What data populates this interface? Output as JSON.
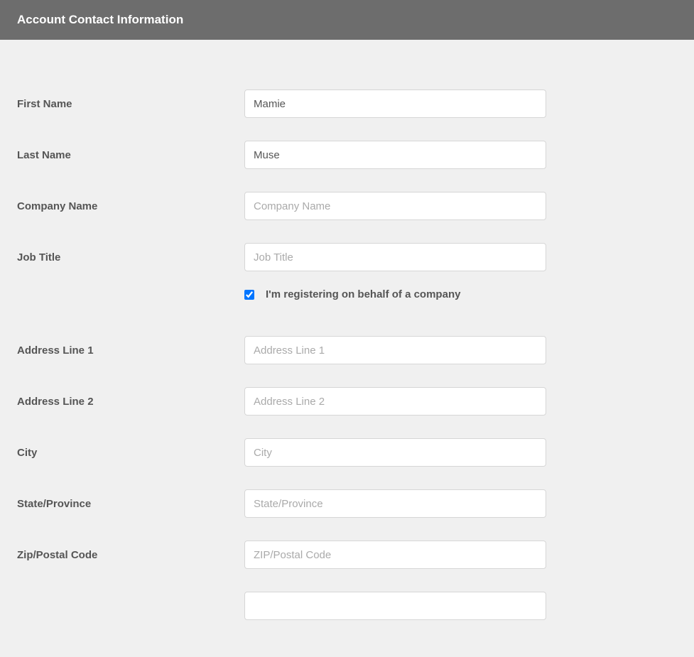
{
  "header": {
    "title": "Account Contact Information"
  },
  "form": {
    "first_name": {
      "label": "First Name",
      "value": "Mamie",
      "placeholder": "First Name"
    },
    "last_name": {
      "label": "Last Name",
      "value": "Muse",
      "placeholder": "Last Name"
    },
    "company_name": {
      "label": "Company Name",
      "value": "",
      "placeholder": "Company Name"
    },
    "job_title": {
      "label": "Job Title",
      "value": "",
      "placeholder": "Job Title"
    },
    "company_checkbox": {
      "label": "I'm registering on behalf of a company",
      "checked": true
    },
    "address_line_1": {
      "label": "Address Line 1",
      "value": "",
      "placeholder": "Address Line 1"
    },
    "address_line_2": {
      "label": "Address Line 2",
      "value": "",
      "placeholder": "Address Line 2"
    },
    "city": {
      "label": "City",
      "value": "",
      "placeholder": "City"
    },
    "state_province": {
      "label": "State/Province",
      "value": "",
      "placeholder": "State/Province"
    },
    "zip_postal": {
      "label": "Zip/Postal Code",
      "value": "",
      "placeholder": "ZIP/Postal Code"
    }
  }
}
